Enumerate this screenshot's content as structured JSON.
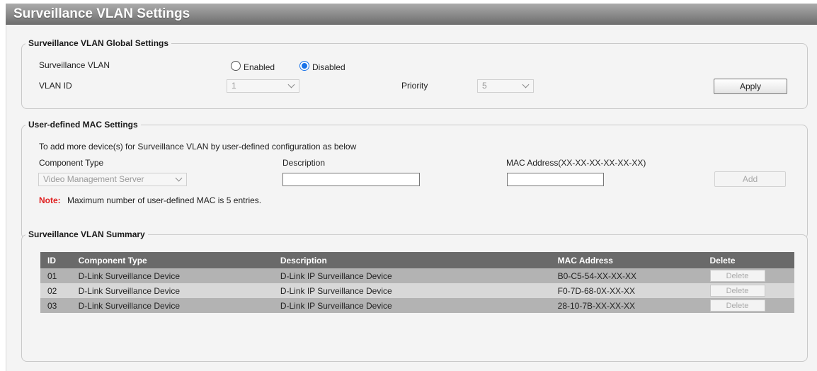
{
  "page": {
    "title": "Surveillance VLAN Settings"
  },
  "global_settings": {
    "legend": "Surveillance VLAN Global Settings",
    "surveillance_vlan_label": "Surveillance VLAN",
    "enabled_label": "Enabled",
    "disabled_label": "Disabled",
    "selected_state": "Disabled",
    "vlan_id_label": "VLAN ID",
    "vlan_id_value": "1",
    "priority_label": "Priority",
    "priority_value": "5",
    "apply_label": "Apply"
  },
  "mac_settings": {
    "legend": "User-defined MAC Settings",
    "intro": "To add more device(s) for Surveillance VLAN by user-defined configuration as below",
    "component_type_label": "Component Type",
    "component_type_value": "Video Management Server",
    "description_label": "Description",
    "description_value": "",
    "mac_label": "MAC Address(XX-XX-XX-XX-XX-XX)",
    "mac_value": "",
    "add_label": "Add",
    "note_key": "Note:",
    "note_text": "Maximum number of user-defined MAC is 5 entries."
  },
  "summary": {
    "legend": "Surveillance VLAN Summary",
    "columns": [
      "ID",
      "Component Type",
      "Description",
      "MAC Address",
      "Delete"
    ],
    "rows": [
      {
        "id": "01",
        "component": "D-Link Surveillance Device",
        "description": "D-Link IP Surveillance Device",
        "mac": "B0-C5-54-XX-XX-XX",
        "delete": "Delete"
      },
      {
        "id": "02",
        "component": "D-Link Surveillance Device",
        "description": "D-Link IP Surveillance Device",
        "mac": "F0-7D-68-0X-XX-XX",
        "delete": "Delete"
      },
      {
        "id": "03",
        "component": "D-Link Surveillance Device",
        "description": "D-Link IP Surveillance Device",
        "mac": "28-10-7B-XX-XX-XX",
        "delete": "Delete"
      }
    ]
  },
  "colors": {
    "title_bar_top": "#ababab",
    "title_bar_bottom": "#6d6d6d",
    "table_header": "#6a6a6a",
    "row_odd": "#b3b3b3",
    "row_even": "#d8d8d8",
    "note_red": "#e02020",
    "radio_blue": "#1a73e8"
  }
}
